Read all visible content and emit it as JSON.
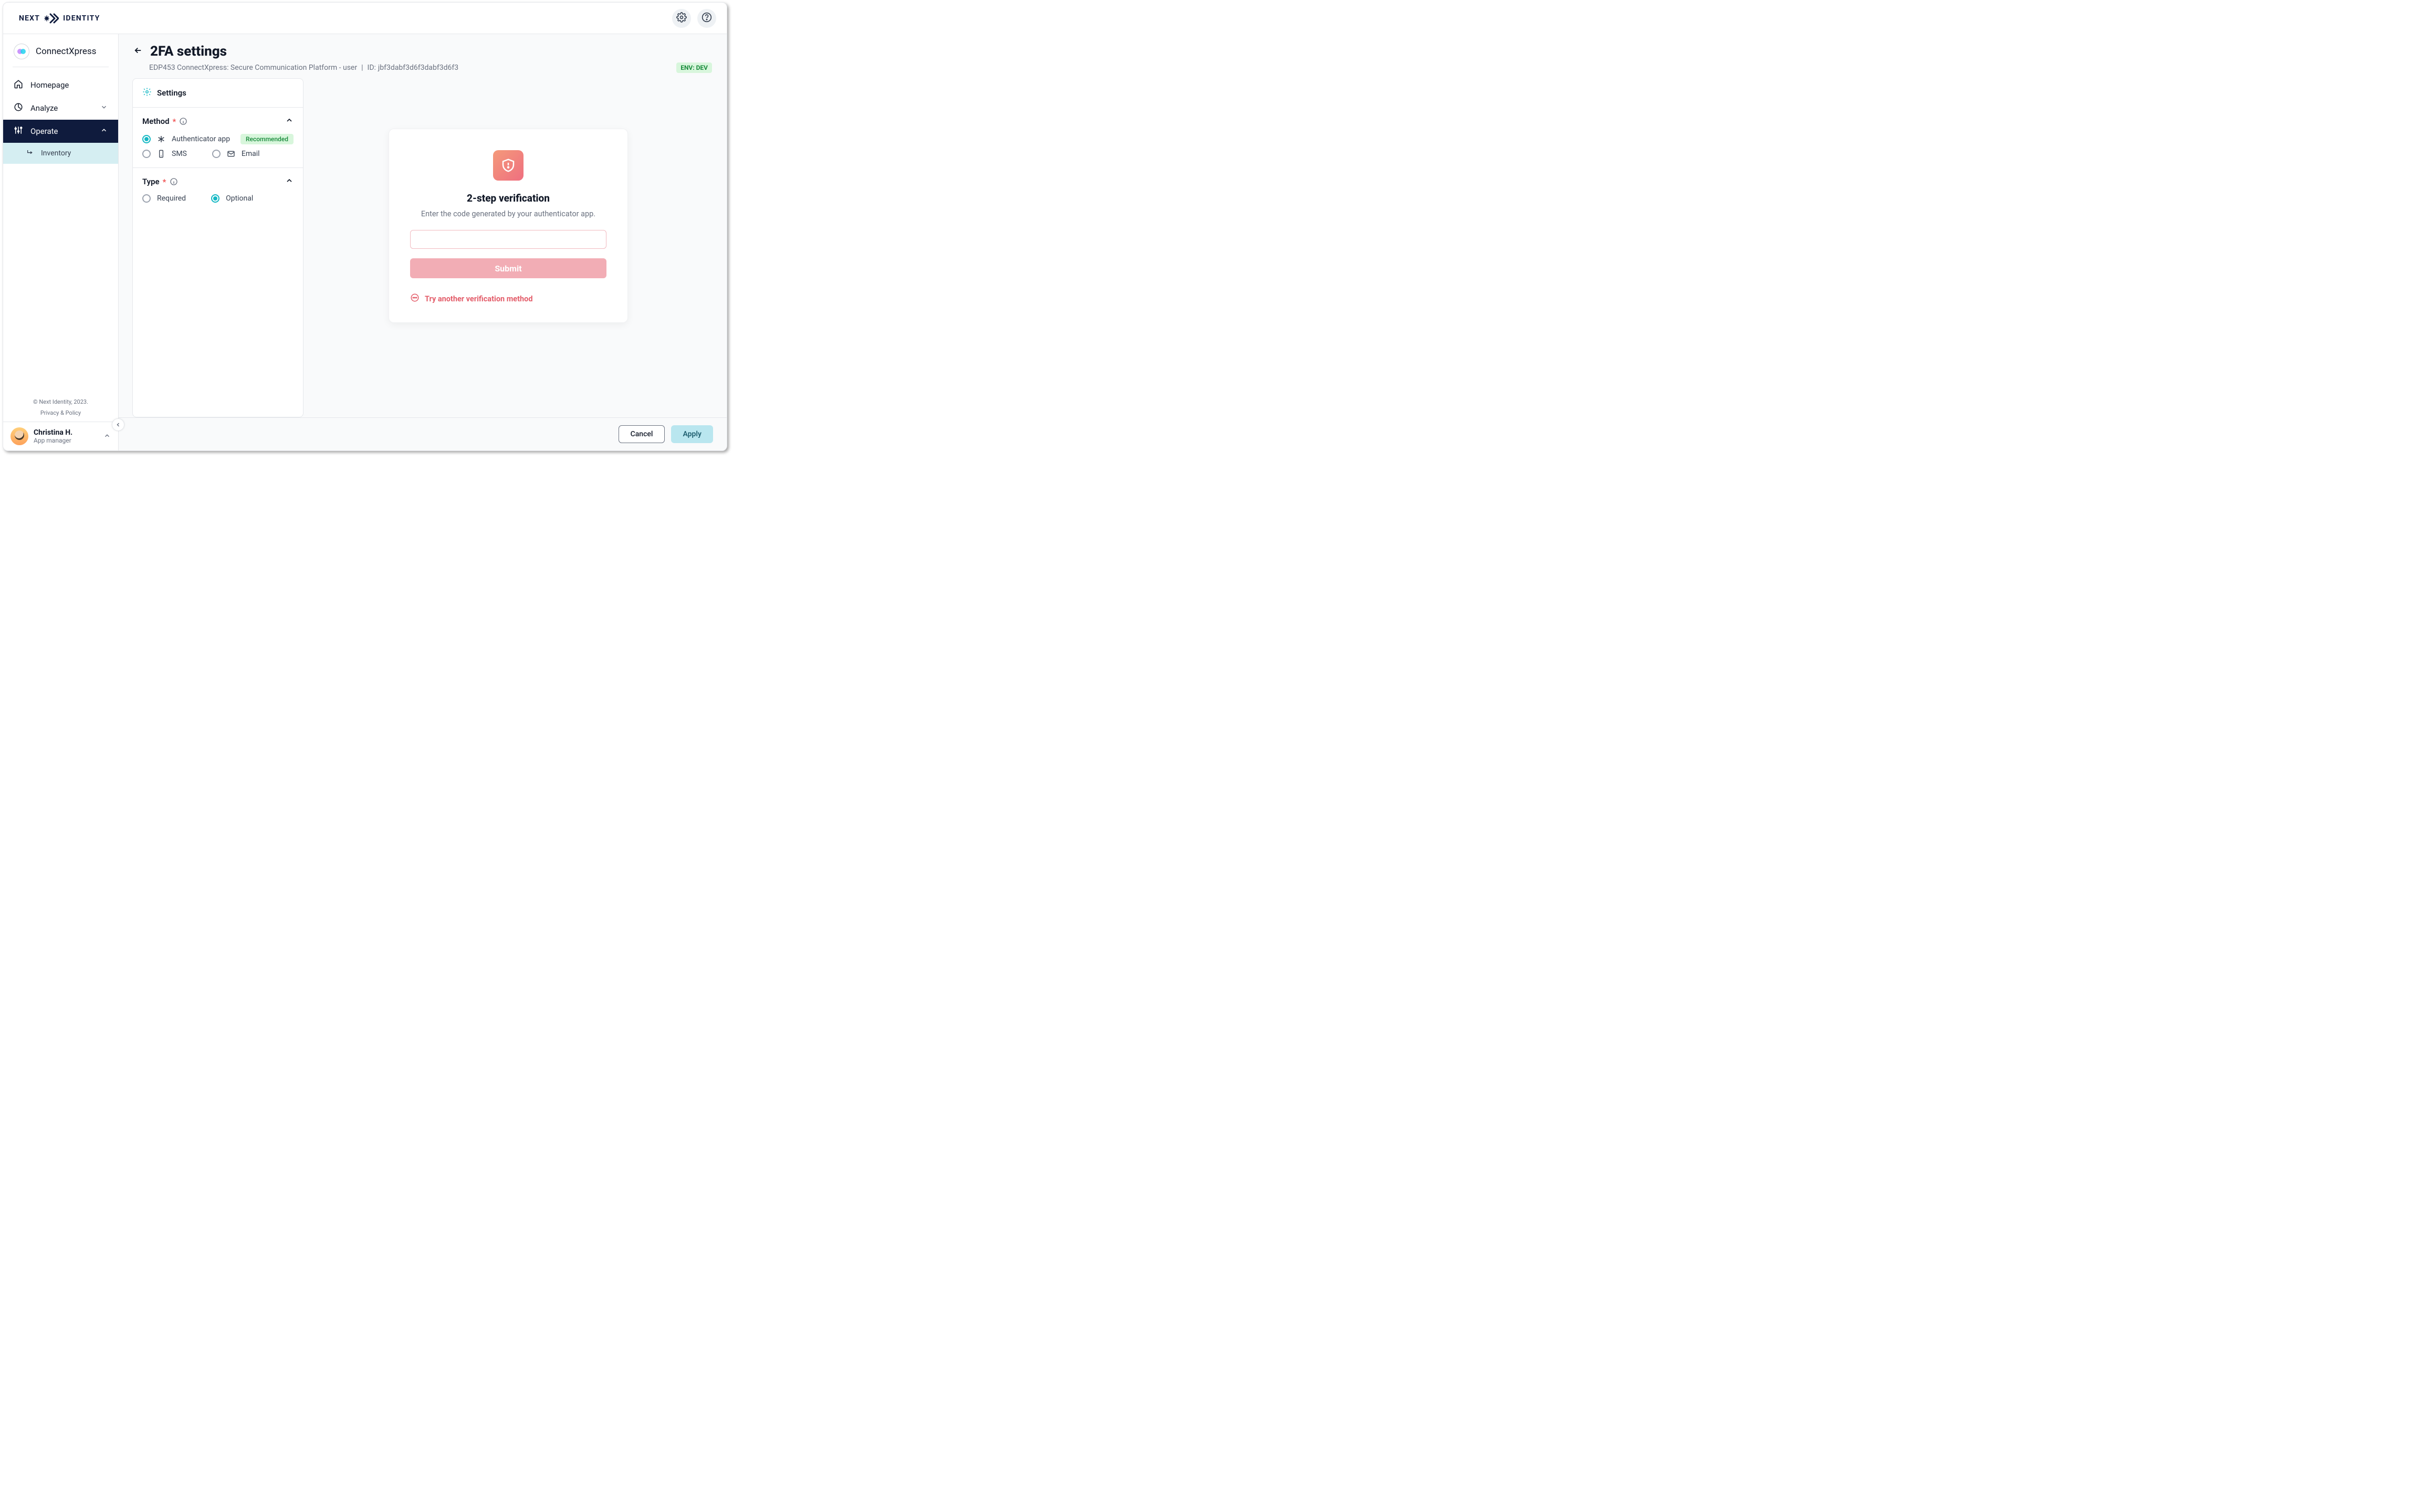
{
  "brand": {
    "text1": "NEXT",
    "text2": "IDENTITY"
  },
  "project": {
    "name": "ConnectXpress"
  },
  "sidebar": {
    "items": [
      {
        "label": "Homepage"
      },
      {
        "label": "Analyze"
      },
      {
        "label": "Operate"
      },
      {
        "label": "Inventory"
      }
    ],
    "copyright": "© Next Identity, 2023.",
    "legal": "Privacy & Policy"
  },
  "user": {
    "name": "Christina H.",
    "role": "App manager"
  },
  "page": {
    "title": "2FA settings",
    "context": "EDP453 ConnectXpress: Secure Communication Platform - user",
    "context_sep": "|",
    "id_label": "ID:",
    "id_value": "jbf3dabf3d6f3dabf3d6f3",
    "env_chip": "ENV: DEV"
  },
  "settings": {
    "panel_title": "Settings",
    "method": {
      "title": "Method",
      "options": {
        "authenticator": "Authenticator app",
        "sms": "SMS",
        "email": "Email"
      },
      "recommended_chip": "Recommended"
    },
    "type": {
      "title": "Type",
      "options": {
        "required": "Required",
        "optional": "Optional"
      }
    }
  },
  "preview": {
    "title": "2-step verification",
    "subtitle": "Enter the code generated by your authenticator app.",
    "submit": "Submit",
    "try_another": "Try another verification method"
  },
  "footer": {
    "cancel": "Cancel",
    "apply": "Apply"
  }
}
